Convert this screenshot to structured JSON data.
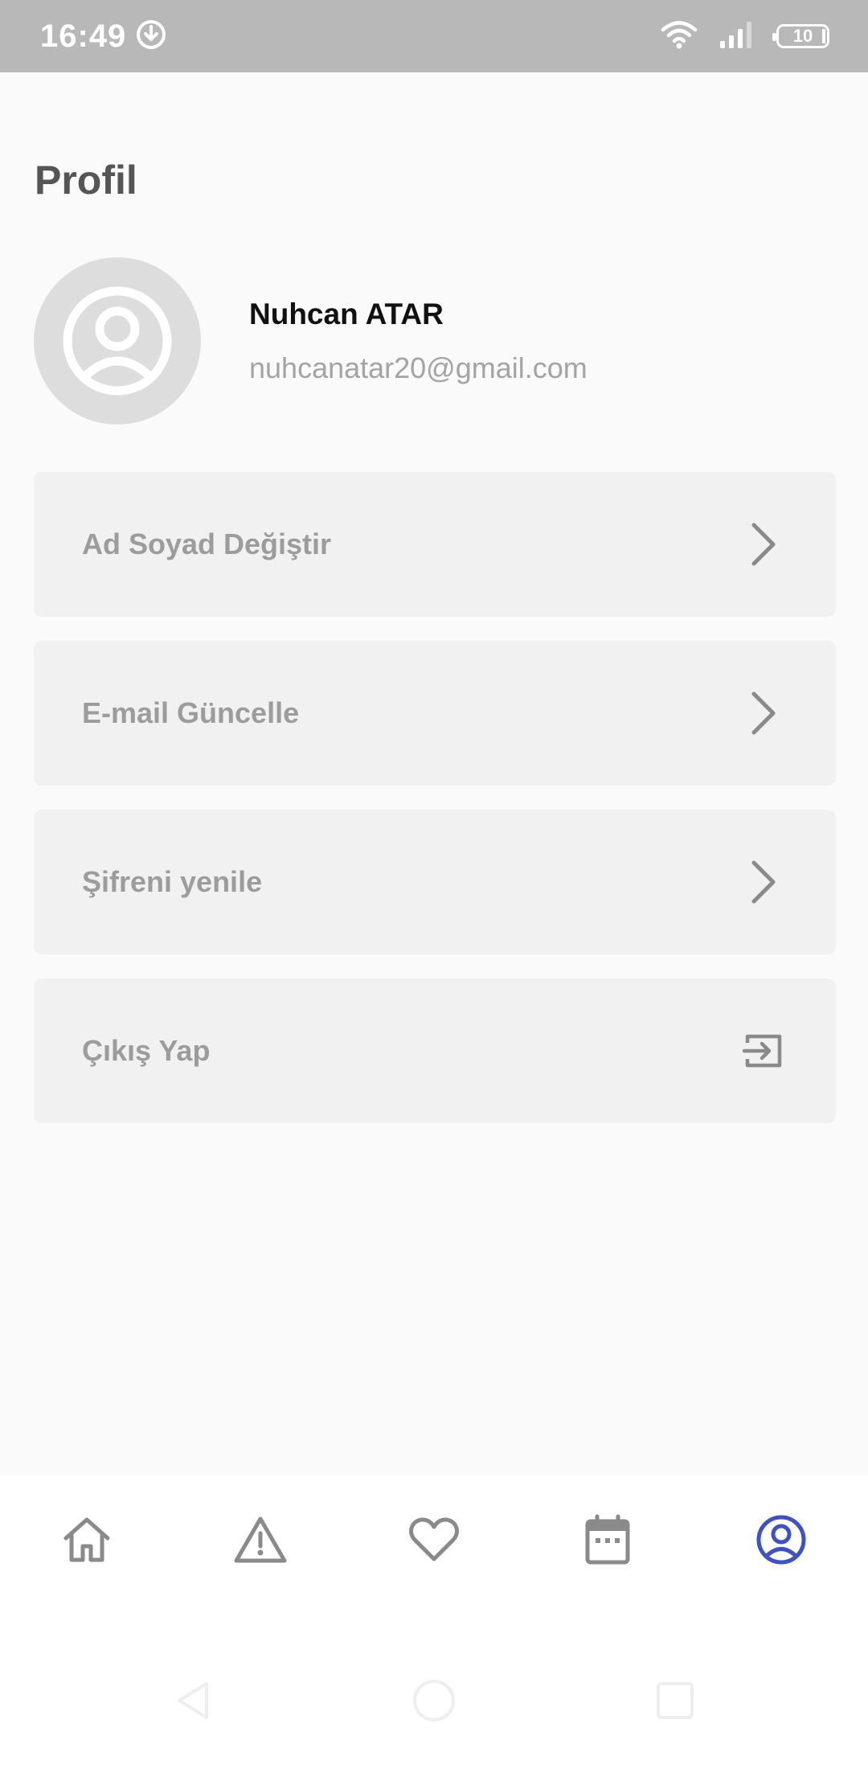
{
  "status_bar": {
    "time": "16:49",
    "battery": "10",
    "icons": [
      "download-icon",
      "wifi-icon",
      "signal-icon",
      "battery-icon"
    ]
  },
  "page": {
    "title": "Profil"
  },
  "profile": {
    "name": "Nuhcan ATAR",
    "email": "nuhcanatar20@gmail.com"
  },
  "menu": {
    "items": [
      {
        "label": "Ad Soyad Değiştir",
        "icon": "chevron-right-icon"
      },
      {
        "label": "E-mail Güncelle",
        "icon": "chevron-right-icon"
      },
      {
        "label": "Şifreni yenile",
        "icon": "chevron-right-icon"
      },
      {
        "label": "Çıkış Yap",
        "icon": "logout-icon"
      }
    ]
  },
  "bottom_nav": {
    "items": [
      "home-icon",
      "warning-icon",
      "heart-icon",
      "calendar-icon",
      "profile-icon"
    ],
    "active": "profile-icon"
  },
  "colors": {
    "accent": "#3f51c7",
    "icon_gray": "#8a8a8a",
    "status_bar": "#b8b8b8",
    "card": "#f1f1f1"
  }
}
